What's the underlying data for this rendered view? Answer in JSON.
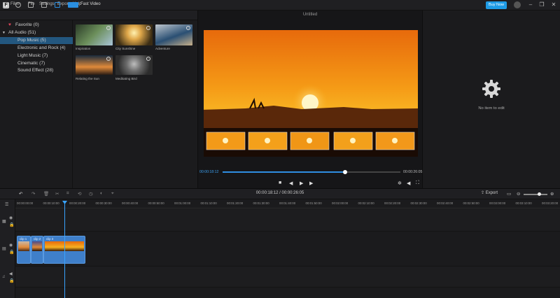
{
  "app": {
    "name": "Filmr",
    "title": "Untitled",
    "buy_label": "Buy Now"
  },
  "menu": [
    "File",
    "Settings",
    "Export",
    "Help"
  ],
  "media_toolbar": {
    "fast_video_label": "Fast Video"
  },
  "tree": [
    {
      "label": "Favorite (0)",
      "icon": "heart-icon"
    },
    {
      "label": "All Audio (51)",
      "icon": "caret-down-icon"
    },
    {
      "label": "Pop Music (5)",
      "selected": true
    },
    {
      "label": "Electronic and Rock (4)"
    },
    {
      "label": "Light Music (7)"
    },
    {
      "label": "Cinematic (7)"
    },
    {
      "label": "Sound Effect (28)"
    }
  ],
  "media": [
    {
      "label": "Inspiration",
      "colors": [
        "#2b3b28",
        "#6c8f5b"
      ]
    },
    {
      "label": "City Sunshine",
      "colors": [
        "#3b2d15",
        "#f2d37a"
      ]
    },
    {
      "label": "Adventure",
      "colors": [
        "#2a4f73",
        "#bfc7cf"
      ]
    },
    {
      "label": "Relating the Sun",
      "colors": [
        "#1a2b3d",
        "#e08a3a"
      ]
    },
    {
      "label": "Meditating Bird",
      "colors": [
        "#2c2c2c",
        "#9a9a9a"
      ]
    }
  ],
  "player": {
    "current_time": "00:00:18:12",
    "total_time": "00:00:26:05",
    "progress": 0.69
  },
  "properties": {
    "empty_label": "No item to edit"
  },
  "timeline": {
    "time_display": "00:00:18:12  /  00:00:26:05",
    "export_label": "Export",
    "ruler": [
      "00:00:00:00",
      "00:00:10:00",
      "00:00:20:00",
      "00:00:30:00",
      "00:00:40:00",
      "00:00:50:00",
      "00:01:00:00",
      "00:01:10:00",
      "00:01:20:00",
      "00:01:30:00",
      "00:01:40:00",
      "00:01:50:00",
      "00:02:00:00",
      "00:02:10:00",
      "00:02:20:00",
      "00:02:30:00",
      "00:02:40:00",
      "00:02:50:00",
      "00:03:00:00",
      "00:03:10:00",
      "00:03:20:00"
    ],
    "clips": [
      {
        "label": "clip 1"
      },
      {
        "label": "clip 2"
      },
      {
        "label": "clip 3"
      }
    ]
  },
  "colors": {
    "accent": "#2f8ee3",
    "selected": "#23577f",
    "clip": "#3f7fc9"
  }
}
